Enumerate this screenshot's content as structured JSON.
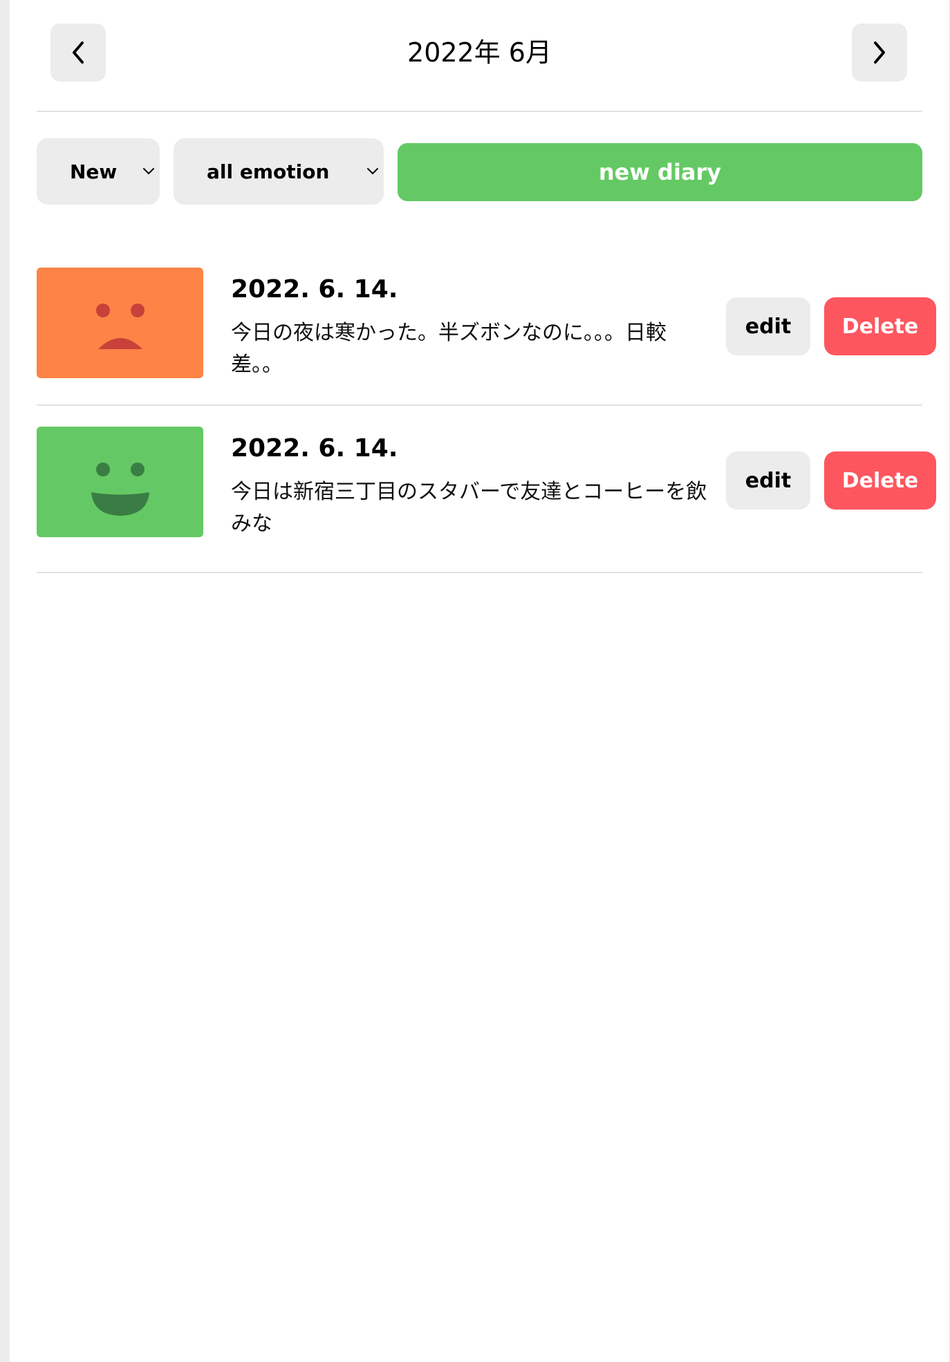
{
  "header": {
    "title": "2022年 6月",
    "prev_icon": "chevron-left-icon",
    "next_icon": "chevron-right-icon"
  },
  "controls": {
    "sort_value": "New",
    "emotion_value": "all emotion",
    "new_diary_label": "new diary"
  },
  "colors": {
    "accent_green": "#64c964",
    "delete_red": "#fd565f",
    "emotion_bad": "#fd8446",
    "emotion_good": "#64c964"
  },
  "diaries": [
    {
      "date": "2022. 6. 14.",
      "content": "今日の夜は寒かった。半ズボンなのに。。。日較差。。",
      "emotion_icon": "sad-face-icon",
      "edit_label": "edit",
      "delete_label": "Delete"
    },
    {
      "date": "2022. 6. 14.",
      "content": "今日は新宿三丁目のスタバーで友達とコーヒーを飲みな",
      "emotion_icon": "happy-face-icon",
      "edit_label": "edit",
      "delete_label": "Delete"
    }
  ]
}
